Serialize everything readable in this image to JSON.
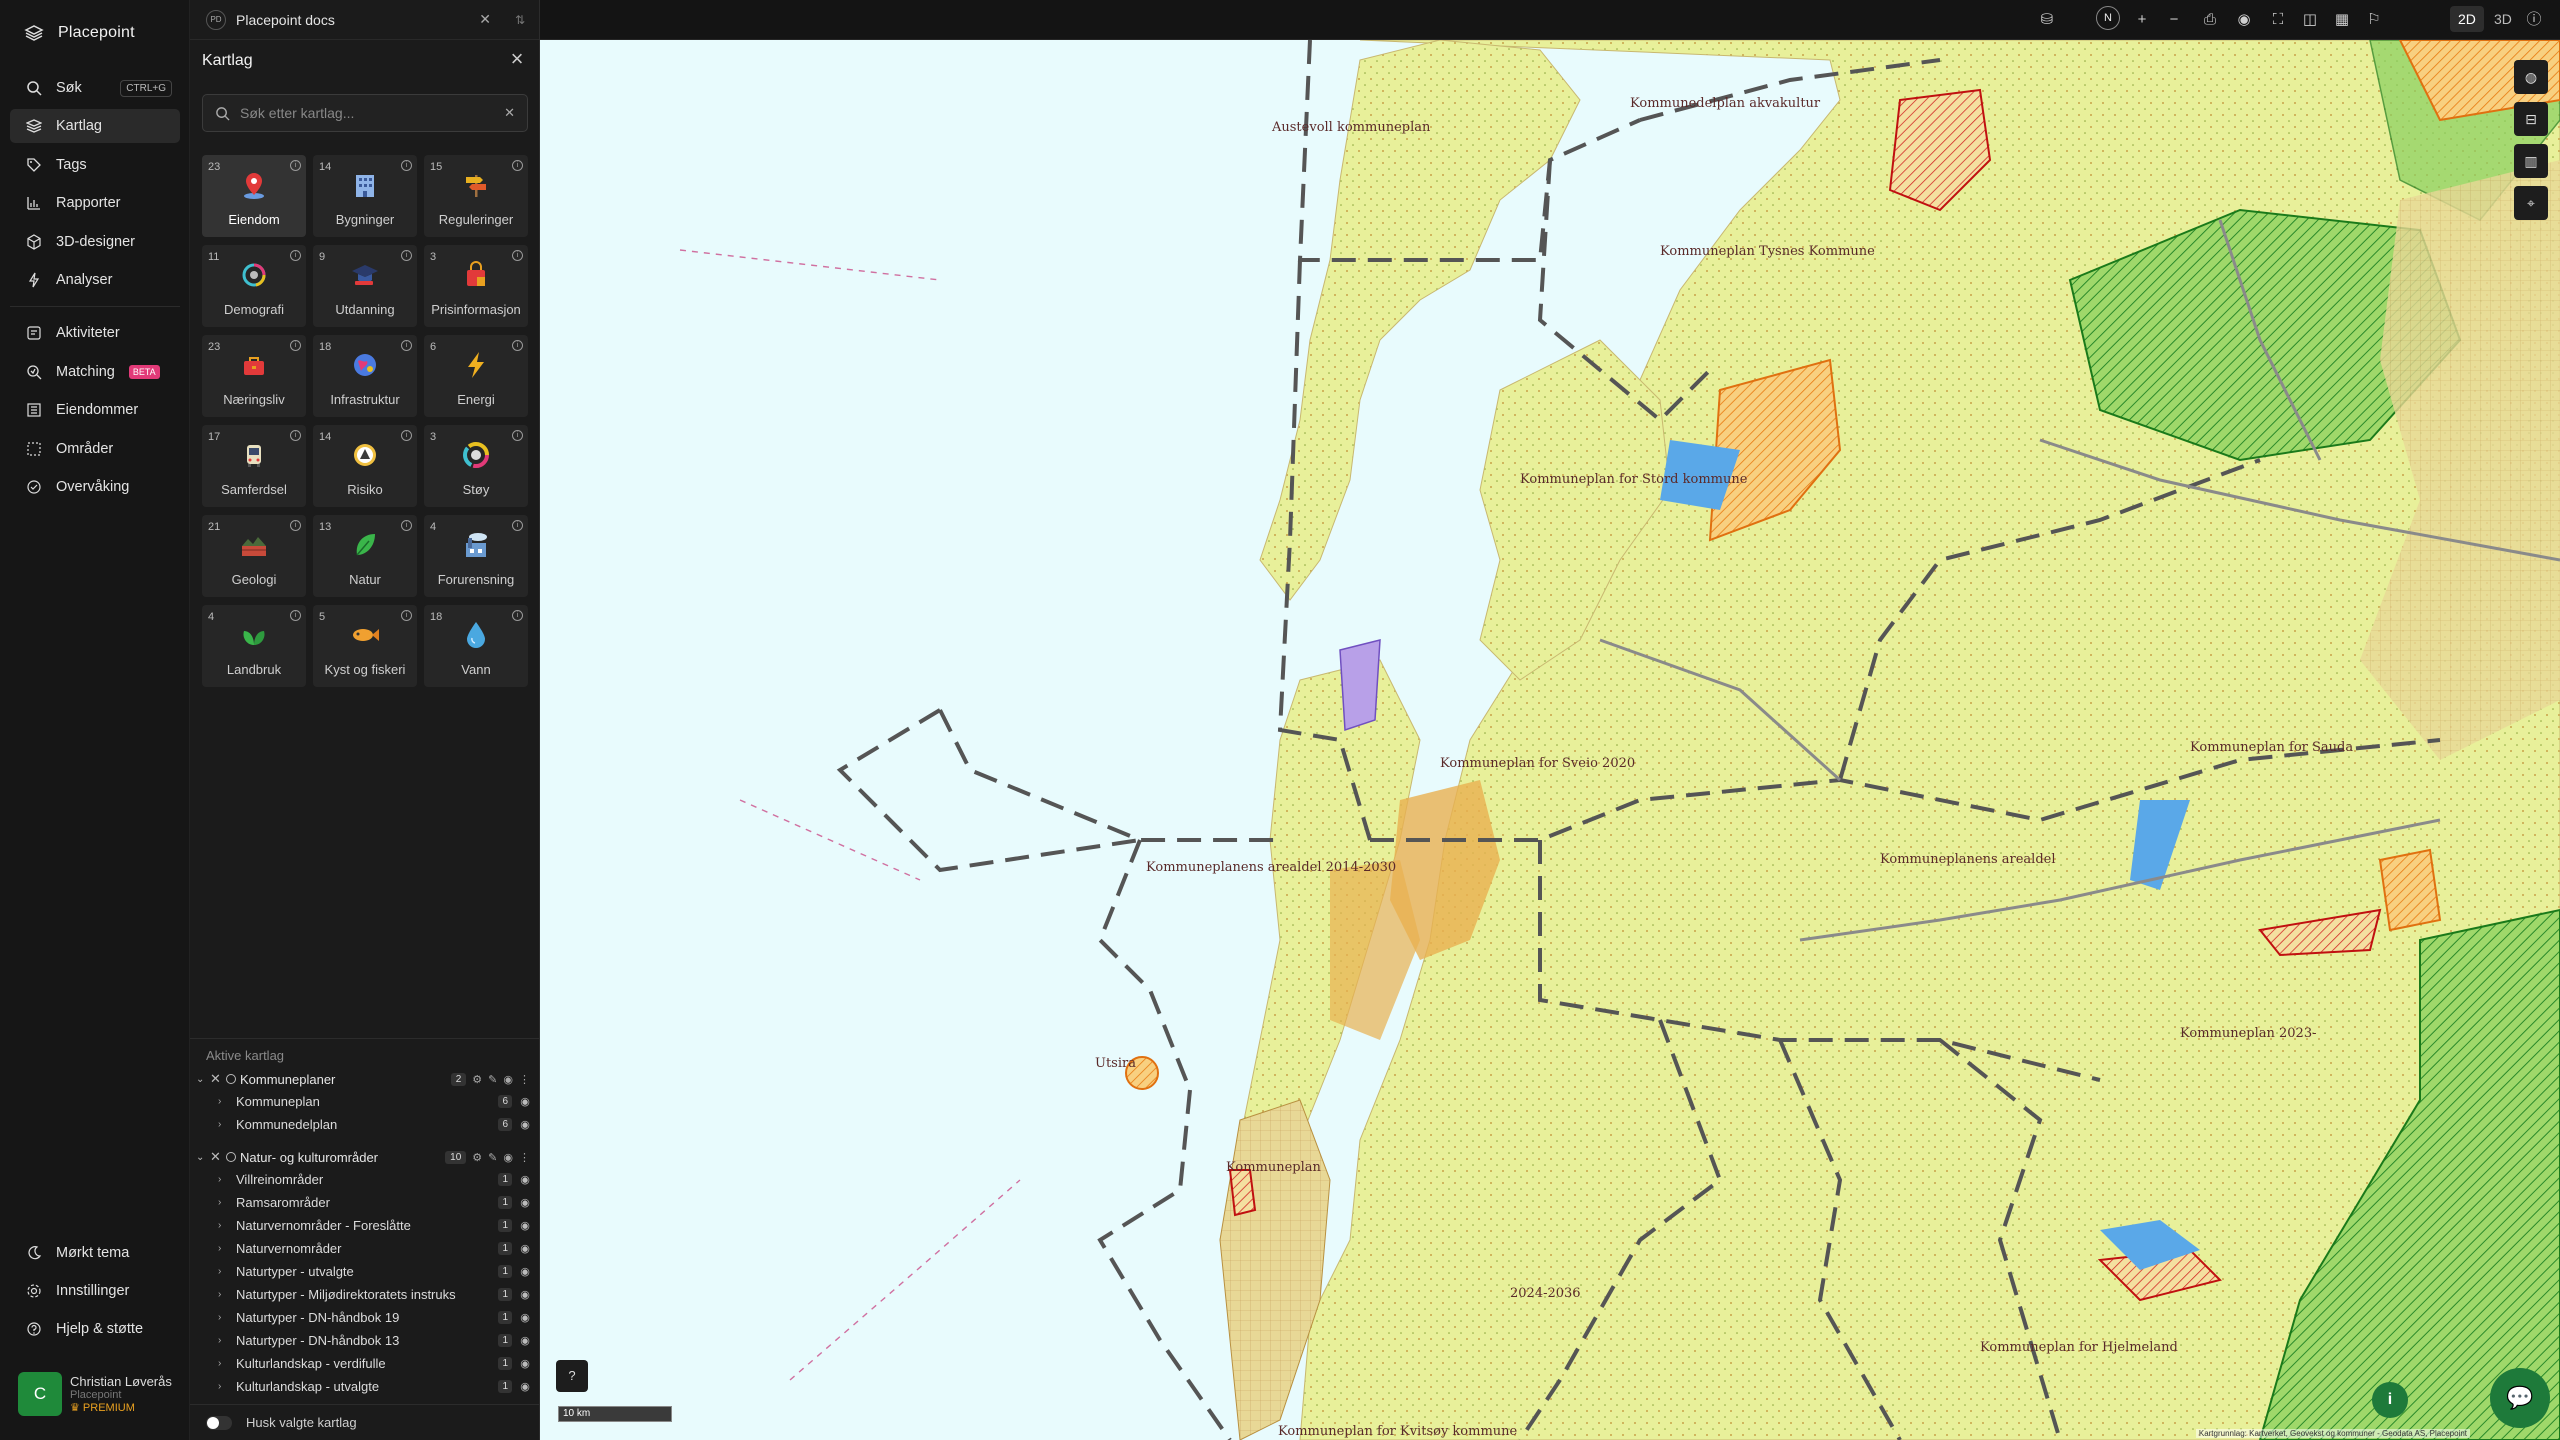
{
  "app": {
    "name": "Placepoint"
  },
  "nav": {
    "search_label": "Søk",
    "search_shortcut": "CTRL+G",
    "items": [
      {
        "label": "Kartlag"
      },
      {
        "label": "Tags"
      },
      {
        "label": "Rapporter"
      },
      {
        "label": "3D-designer"
      },
      {
        "label": "Analyser"
      },
      {
        "label": "Aktiviteter"
      },
      {
        "label": "Matching",
        "badge": "BETA"
      },
      {
        "label": "Eiendommer"
      },
      {
        "label": "Områder"
      },
      {
        "label": "Overvåking"
      }
    ],
    "bottom": [
      {
        "label": "Mørkt tema"
      },
      {
        "label": "Innstillinger"
      },
      {
        "label": "Hjelp & støtte"
      }
    ],
    "user": {
      "initial": "C",
      "name": "Christian Løverås",
      "org": "Placepoint",
      "plan": "PREMIUM"
    }
  },
  "doc_tab": {
    "badge": "PD",
    "title": "Placepoint docs"
  },
  "panel": {
    "title": "Kartlag",
    "search_placeholder": "Søk etter kartlag...",
    "categories": [
      {
        "count": "23",
        "label": "Eiendom",
        "icon": "map-pin-icon"
      },
      {
        "count": "14",
        "label": "Bygninger",
        "icon": "building-icon"
      },
      {
        "count": "15",
        "label": "Reguleringer",
        "icon": "signpost-icon"
      },
      {
        "count": "11",
        "label": "Demografi",
        "icon": "pie-chart-icon"
      },
      {
        "count": "9",
        "label": "Utdanning",
        "icon": "graduation-cap-icon"
      },
      {
        "count": "3",
        "label": "Prisinformasjon",
        "icon": "shopping-bag-icon"
      },
      {
        "count": "23",
        "label": "Næringsliv",
        "icon": "briefcase-icon"
      },
      {
        "count": "18",
        "label": "Infrastruktur",
        "icon": "globe-icon"
      },
      {
        "count": "6",
        "label": "Energi",
        "icon": "lightning-icon"
      },
      {
        "count": "17",
        "label": "Samferdsel",
        "icon": "bus-icon"
      },
      {
        "count": "14",
        "label": "Risiko",
        "icon": "warning-icon"
      },
      {
        "count": "3",
        "label": "Støy",
        "icon": "noise-gauge-icon"
      },
      {
        "count": "21",
        "label": "Geologi",
        "icon": "terrain-icon"
      },
      {
        "count": "13",
        "label": "Natur",
        "icon": "leaf-icon"
      },
      {
        "count": "4",
        "label": "Forurensning",
        "icon": "factory-icon"
      },
      {
        "count": "4",
        "label": "Landbruk",
        "icon": "plant-icon"
      },
      {
        "count": "5",
        "label": "Kyst og fiskeri",
        "icon": "fish-icon"
      },
      {
        "count": "18",
        "label": "Vann",
        "icon": "water-drop-icon"
      }
    ],
    "active_header": "Aktive kartlag",
    "groups": [
      {
        "name": "Kommuneplaner",
        "count": "2",
        "layers": [
          {
            "name": "Kommuneplan",
            "count": "6"
          },
          {
            "name": "Kommunedelplan",
            "count": "6"
          }
        ]
      },
      {
        "name": "Natur- og kulturområder",
        "count": "10",
        "layers": [
          {
            "name": "Villreinområder",
            "count": "1"
          },
          {
            "name": "Ramsarområder",
            "count": "1"
          },
          {
            "name": "Naturvernområder - Foreslåtte",
            "count": "1"
          },
          {
            "name": "Naturvernområder",
            "count": "1"
          },
          {
            "name": "Naturtyper - utvalgte",
            "count": "1"
          },
          {
            "name": "Naturtyper - Miljødirektoratets instruks",
            "count": "1"
          },
          {
            "name": "Naturtyper - DN-håndbok 19",
            "count": "1"
          },
          {
            "name": "Naturtyper - DN-håndbok 13",
            "count": "1"
          },
          {
            "name": "Kulturlandskap - verdifulle",
            "count": "1"
          },
          {
            "name": "Kulturlandskap - utvalgte",
            "count": "1"
          }
        ]
      }
    ],
    "remember_label": "Husk valgte kartlag"
  },
  "toolbar": {
    "north": "N",
    "mode_2d": "2D",
    "mode_3d": "3D"
  },
  "map": {
    "scale": "10 km",
    "attribution": "Kartgrunnlag: Kartverket, Geovekst og kommuner - Geodata AS, Placepoint",
    "labels": [
      "Austevoll kommuneplan",
      "Kommunedelplan akvakultur",
      "Kommuneplan Tysnes Kommune",
      "Kommuneplan for Stord kommune",
      "Kommuneplan for Sveio 2020",
      "Kommuneplanens arealdel 2014-2030",
      "Kommuneplan for Sauda",
      "Kommuneplanens arealdel",
      "Utsira",
      "Kommuneplan",
      "Kommuneplan for Kvitsøy kommune",
      "Kommuneplan for Hjelmeland",
      "2024-2036",
      "Kommuneplan 2023-"
    ]
  }
}
